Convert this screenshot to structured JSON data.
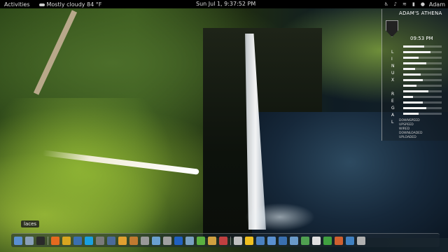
{
  "top_panel": {
    "activities_label": "Activities",
    "weather_text": "Mostly cloudy 84 °F",
    "clock_text": "Sun Jul  1,  9:37:52 PM",
    "user_name": "Adam"
  },
  "conky": {
    "title": "ADAM'S ATHENA",
    "time": "09:53 PM",
    "vertical_letters_1": [
      "L",
      "I",
      "N",
      "U",
      "X"
    ],
    "vertical_letters_2": [
      "R",
      "E",
      "G",
      "A",
      "L"
    ],
    "meters": [
      0.55,
      0.7,
      0.4,
      0.6,
      0.3,
      0.45,
      0.5,
      0.35,
      0.65,
      0.25,
      0.5,
      0.6,
      0.4
    ],
    "small_lines": [
      "DOWNSPEED",
      "UPSPEED",
      "WIRED",
      "DOWNLOADED",
      "UPLOADED"
    ]
  },
  "tooltip": {
    "text": "laces"
  },
  "dock": {
    "items": [
      {
        "icon": "home-icon",
        "color": "#5a8fd0"
      },
      {
        "icon": "folder-icon",
        "color": "#8aa0b8"
      },
      {
        "icon": "terminal-icon",
        "color": "#2a2a2a"
      },
      {
        "icon": "firefox-icon",
        "color": "#e66a1f"
      },
      {
        "icon": "chrome-icon",
        "color": "#d9a520"
      },
      {
        "icon": "thunderbird-icon",
        "color": "#3b6fb0"
      },
      {
        "icon": "skype-icon",
        "color": "#1aa0e0"
      },
      {
        "icon": "settings-icon",
        "color": "#7a7a7a"
      },
      {
        "icon": "editor-icon",
        "color": "#4a6a9a"
      },
      {
        "icon": "music-icon",
        "color": "#e0a030"
      },
      {
        "icon": "package-icon",
        "color": "#c07a30"
      },
      {
        "icon": "tools-icon",
        "color": "#999999"
      },
      {
        "icon": "network-icon",
        "color": "#6aa0d0"
      },
      {
        "icon": "gear-icon",
        "color": "#a0a0a0"
      },
      {
        "icon": "bluetooth-icon",
        "color": "#2060c0"
      },
      {
        "icon": "window-icon",
        "color": "#7aa0c0"
      },
      {
        "icon": "leaf-icon",
        "color": "#5ab040"
      },
      {
        "icon": "headphones-icon",
        "color": "#d0a040"
      },
      {
        "icon": "game-icon",
        "color": "#c04040"
      },
      {
        "icon": "mail-icon",
        "color": "#c0c0c0"
      },
      {
        "icon": "tux-icon",
        "color": "#f0c020"
      },
      {
        "icon": "monitor-icon",
        "color": "#4a80c0"
      },
      {
        "icon": "display-icon",
        "color": "#5a90d0"
      },
      {
        "icon": "app-icon",
        "color": "#3a70b0"
      },
      {
        "icon": "image-icon",
        "color": "#6a9ac8"
      },
      {
        "icon": "chart-icon",
        "color": "#50a050"
      },
      {
        "icon": "document-icon",
        "color": "#e0e0e0"
      },
      {
        "icon": "spreadsheet-icon",
        "color": "#40a040"
      },
      {
        "icon": "presentation-icon",
        "color": "#d06030"
      },
      {
        "icon": "calendar-icon",
        "color": "#4080c0"
      },
      {
        "icon": "trash-icon",
        "color": "#b0b0b0"
      }
    ]
  }
}
